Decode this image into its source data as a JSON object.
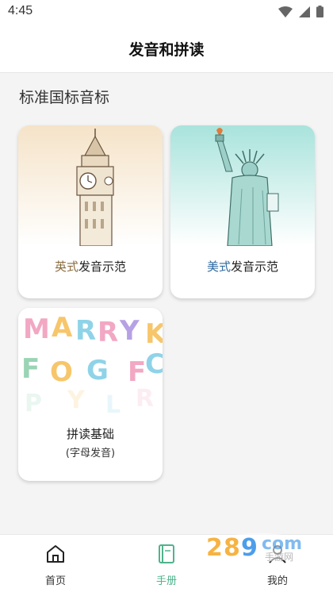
{
  "status_bar": {
    "time": "4:45"
  },
  "header": {
    "title": "发音和拼读"
  },
  "section": {
    "title": "标准国标音标"
  },
  "cards": [
    {
      "accent": "英式",
      "label": "发音示范"
    },
    {
      "accent": "美式",
      "label": "发音示范"
    },
    {
      "label": "拼读基础",
      "sublabel": "(字母发音)"
    }
  ],
  "tabs": [
    {
      "label": "首页",
      "icon": "home-icon"
    },
    {
      "label": "手册",
      "icon": "book-icon"
    },
    {
      "label": "我的",
      "icon": "user-icon"
    }
  ],
  "colors": {
    "active_tab": "#4fb38c",
    "british_accent": "#8a6c3e",
    "american_accent": "#2f6aa0"
  }
}
